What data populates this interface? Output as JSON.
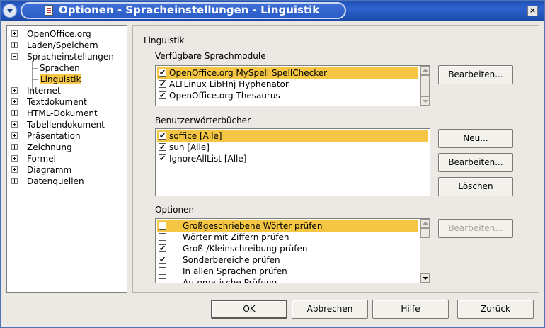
{
  "window": {
    "title": "Optionen - Spracheinstellungen - Linguistik",
    "close": "×"
  },
  "tree": {
    "items": [
      {
        "label": "OpenOffice.org",
        "level": 0,
        "expander": "plus"
      },
      {
        "label": "Laden/Speichern",
        "level": 0,
        "expander": "plus"
      },
      {
        "label": "Spracheinstellungen",
        "level": 0,
        "expander": "minus"
      },
      {
        "label": "Sprachen",
        "level": 1
      },
      {
        "label": "Linguistik",
        "level": 1,
        "selected": true
      },
      {
        "label": "Internet",
        "level": 0,
        "expander": "plus"
      },
      {
        "label": "Textdokument",
        "level": 0,
        "expander": "plus"
      },
      {
        "label": "HTML-Dokument",
        "level": 0,
        "expander": "plus"
      },
      {
        "label": "Tabellendokument",
        "level": 0,
        "expander": "plus"
      },
      {
        "label": "Präsentation",
        "level": 0,
        "expander": "plus"
      },
      {
        "label": "Zeichnung",
        "level": 0,
        "expander": "plus"
      },
      {
        "label": "Formel",
        "level": 0,
        "expander": "plus"
      },
      {
        "label": "Diagramm",
        "level": 0,
        "expander": "plus"
      },
      {
        "label": "Datenquellen",
        "level": 0,
        "expander": "plus"
      }
    ]
  },
  "panel": {
    "group_title": "Linguistik",
    "modules": {
      "label": "Verfügbare Sprachmodule",
      "items": [
        {
          "label": "OpenOffice.org MySpell SpellChecker",
          "checked": true,
          "highlighted": true
        },
        {
          "label": "ALTLinux LibHnj Hyphenator",
          "checked": true
        },
        {
          "label": "OpenOffice.org Thesaurus",
          "checked": true
        }
      ],
      "edit_button": "Bearbeiten..."
    },
    "dictionaries": {
      "label": "Benutzerwörterbücher",
      "items": [
        {
          "label": "soffice [Alle]",
          "checked": true,
          "highlighted": true
        },
        {
          "label": "sun [Alle]",
          "checked": true
        },
        {
          "label": "IgnoreAllList [Alle]",
          "checked": true
        }
      ],
      "new_button": "Neu...",
      "edit_button": "Bearbeiten...",
      "delete_button": "Löschen"
    },
    "options": {
      "label": "Optionen",
      "items": [
        {
          "label": "Großgeschriebene Wörter prüfen",
          "checked": false,
          "highlighted": true
        },
        {
          "label": "Wörter mit Ziffern prüfen",
          "checked": false
        },
        {
          "label": "Groß-/Kleinschreibung prüfen",
          "checked": true
        },
        {
          "label": "Sonderbereiche prüfen",
          "checked": true
        },
        {
          "label": "In allen Sprachen prüfen",
          "checked": false
        },
        {
          "label": "Automatische Prüfung",
          "checked": false
        }
      ],
      "edit_button": "Bearbeiten..."
    }
  },
  "footer": {
    "ok": "OK",
    "cancel": "Abbrechen",
    "help": "Hilfe",
    "back": "Zurück"
  }
}
